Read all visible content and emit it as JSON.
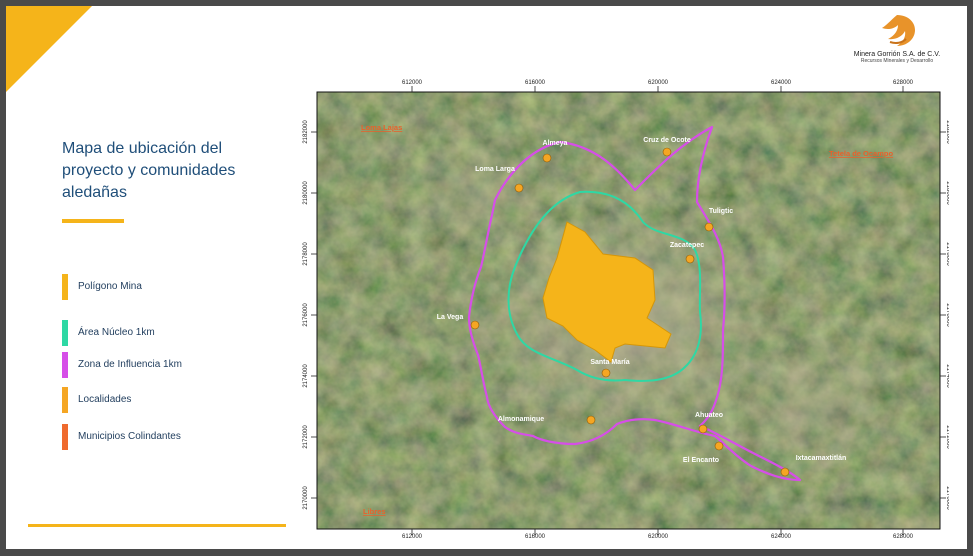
{
  "header": {
    "company": "Minera Gorrión S.A. de C.V.",
    "tagline": "Recursos Minerales y Desarrollo"
  },
  "title": "Mapa de ubicación del proyecto y comunidades aledañas",
  "legend": [
    {
      "label": "Polígono Mina",
      "color": "#f5b41a"
    },
    {
      "label": "Área Núcleo 1km",
      "color": "#2ed8a4"
    },
    {
      "label": "Zona de Influencia 1km",
      "color": "#d64ee8"
    },
    {
      "label": "Localidades",
      "color": "#f5a623"
    },
    {
      "label": "Municipios Colindantes",
      "color": "#ef6a2e"
    }
  ],
  "map": {
    "x_ticks": [
      "612000",
      "616000",
      "620000",
      "624000",
      "628000"
    ],
    "y_ticks": [
      "2182000",
      "2180000",
      "2178000",
      "2176000",
      "2174000",
      "2172000",
      "2170000"
    ],
    "localities": [
      {
        "name": "Almeya"
      },
      {
        "name": "Cruz de Ocote"
      },
      {
        "name": "Loma Larga"
      },
      {
        "name": "Tuligtic"
      },
      {
        "name": "Zacatepec"
      },
      {
        "name": "La Vega"
      },
      {
        "name": "Santa María"
      },
      {
        "name": "Almonamique"
      },
      {
        "name": "Ahuateo"
      },
      {
        "name": "El Encanto"
      },
      {
        "name": "Ixtacamaxtitlán"
      }
    ],
    "municipalities": [
      {
        "name": "Loma Lajas"
      },
      {
        "name": "Tetela de Ocampo"
      },
      {
        "name": "Libres"
      }
    ],
    "colors": {
      "mine": "#f5b41a",
      "core": "#2ed8a4",
      "influence": "#d64ee8",
      "locality": "#f5a623",
      "municipality": "#ef6a2e"
    }
  }
}
